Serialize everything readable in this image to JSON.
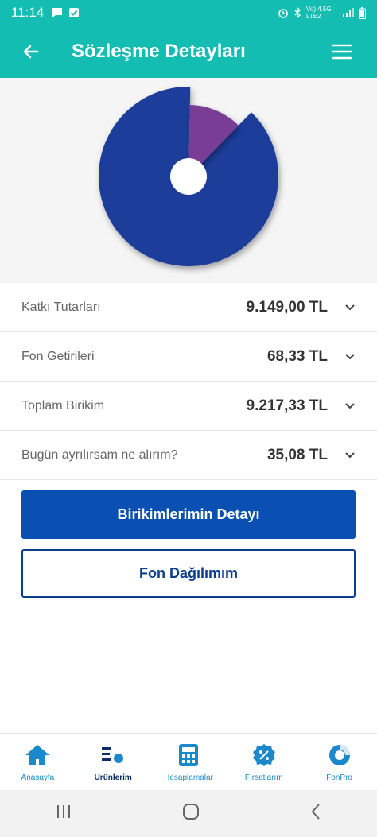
{
  "status": {
    "time": "11:14",
    "network": "Vo) 4.5G LTE2"
  },
  "header": {
    "title": "Sözleşme Detayları"
  },
  "chart_data": {
    "type": "pie",
    "slices": [
      {
        "value": 88,
        "color": "#1c3d9a"
      },
      {
        "value": 12,
        "color": "#7a3d96"
      }
    ]
  },
  "rows": [
    {
      "label": "Katkı Tutarları",
      "value": "9.149,00 TL"
    },
    {
      "label": "Fon Getirileri",
      "value": "68,33 TL"
    },
    {
      "label": "Toplam Birikim",
      "value": "9.217,33 TL"
    },
    {
      "label": "Bugün ayrılırsam ne alırım?",
      "value": "35,08 TL"
    }
  ],
  "buttons": {
    "primary": "Birikimlerimin Detayı",
    "secondary": "Fon Dağılımım"
  },
  "nav": [
    {
      "label": "Anasayfa",
      "icon": "home-icon"
    },
    {
      "label": "Ürünlerim",
      "icon": "products-icon"
    },
    {
      "label": "Hesaplamalar",
      "icon": "calculator-icon"
    },
    {
      "label": "Fırsatlarım",
      "icon": "percent-badge-icon"
    },
    {
      "label": "FonPro",
      "icon": "fonpro-icon"
    }
  ],
  "colors": {
    "header": "#13bdb2",
    "primary_button": "#0a4fb2",
    "nav_label": "#1a88c9"
  }
}
